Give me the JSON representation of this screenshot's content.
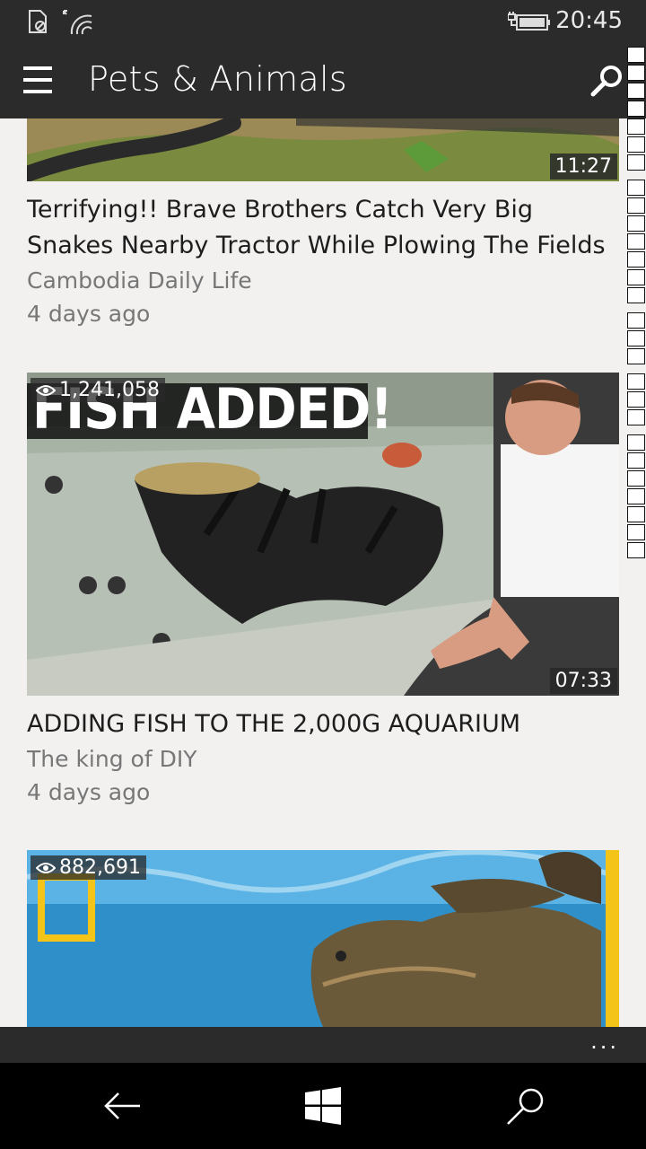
{
  "status": {
    "time": "20:45"
  },
  "header": {
    "title": "Pets & Animals"
  },
  "videos": [
    {
      "title": "Terrifying!! Brave Brothers Catch Very Big Snakes Nearby Tractor While Plowing The Fields",
      "channel": "Cambodia Daily Life",
      "age": "4 days ago",
      "duration": "11:27"
    },
    {
      "title": "ADDING FISH TO THE 2,000G AQUARIUM",
      "channel": "The king of DIY",
      "age": "4 days ago",
      "duration": "07:33",
      "views": "1,241,058",
      "overlay_text": "FISH ADDED!"
    },
    {
      "views": "882,691"
    }
  ],
  "bottom_bar": {
    "more": "..."
  },
  "colors": {
    "bar": "#2b2b2b",
    "background": "#f2f1f0",
    "nav": "#000000"
  }
}
